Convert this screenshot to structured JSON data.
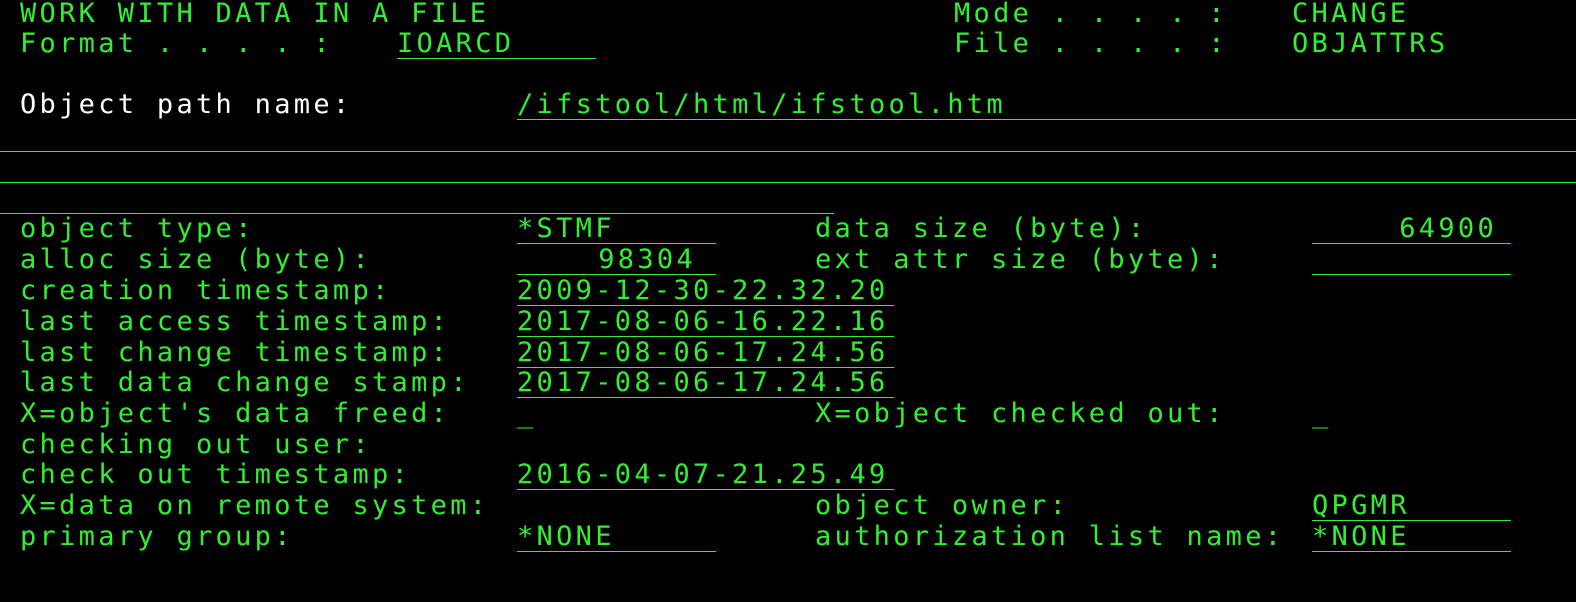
{
  "header": {
    "title": "WORK WITH DATA IN A FILE",
    "format_label": "Format . . . . :",
    "format_value": "IOARCD",
    "mode_label": "Mode . . . . :",
    "mode_value": "CHANGE",
    "file_label": "File . . . . :",
    "file_value": "OBJATTRS"
  },
  "path": {
    "label": "Object path name:",
    "value": "/ifstool/html/ifstool.htm"
  },
  "fields": {
    "object_type_label": "object type:",
    "object_type_value": "*STMF",
    "data_size_label": "data size (byte):",
    "data_size_value": "64900",
    "alloc_size_label": "alloc size (byte):",
    "alloc_size_value": "98304",
    "ext_attr_size_label": "ext attr size (byte):",
    "ext_attr_size_value": "",
    "creation_ts_label": "creation timestamp:",
    "creation_ts_value": "2009-12-30-22.32.20",
    "last_access_ts_label": "last access timestamp:",
    "last_access_ts_value": "2017-08-06-16.22.16",
    "last_change_ts_label": "last change timestamp:",
    "last_change_ts_value": "2017-08-06-17.24.56",
    "last_data_change_label": "last data change stamp:",
    "last_data_change_value": "2017-08-06-17.24.56",
    "data_freed_label": "X=object's data freed:",
    "data_freed_value": "_",
    "checked_out_label": "X=object checked out:",
    "checked_out_value": "_",
    "checkout_user_label": "checking out user:",
    "checkout_user_value": "",
    "checkout_ts_label": "check out timestamp:",
    "checkout_ts_value": "2016-04-07-21.25.49",
    "remote_label": "X=data on remote system:",
    "remote_value": "",
    "owner_label": "object owner:",
    "owner_value": "QPGMR",
    "primary_group_label": "primary group:",
    "primary_group_value": "*NONE",
    "auth_list_label": "authorization list name:",
    "auth_list_value": "*NONE"
  },
  "colors": {
    "background": "#000000",
    "text": "#33ee33",
    "highlight": "#ffffff"
  }
}
